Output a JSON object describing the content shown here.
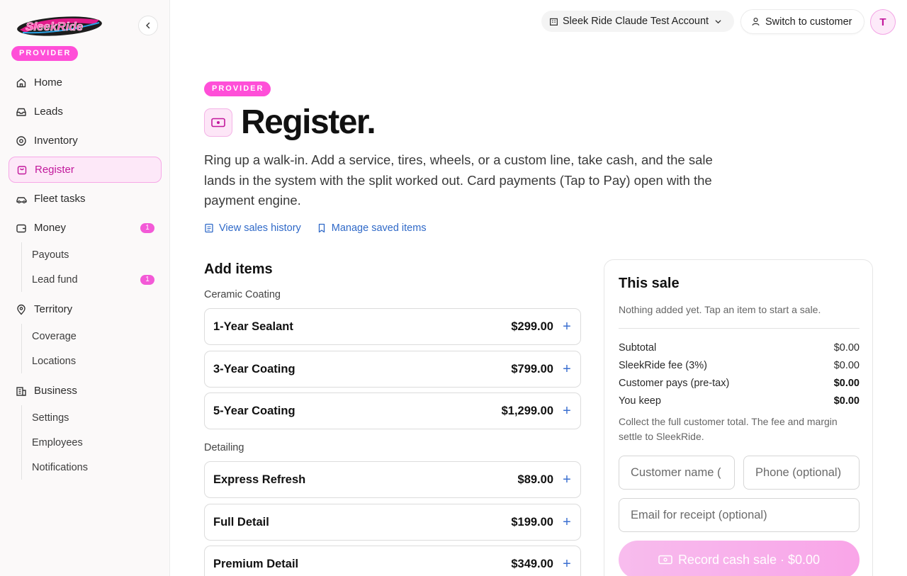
{
  "brand": {
    "logo_text": "SleekRide",
    "role_badge": "PROVIDER",
    "accent": "#ff4fd8"
  },
  "sidebar": {
    "items": [
      {
        "label": "Home",
        "icon": "home-icon"
      },
      {
        "label": "Leads",
        "icon": "inbox-icon"
      },
      {
        "label": "Inventory",
        "icon": "tire-icon"
      },
      {
        "label": "Register",
        "icon": "bag-icon",
        "active": true
      },
      {
        "label": "Fleet tasks",
        "icon": "car-icon"
      },
      {
        "label": "Money",
        "icon": "wallet-icon",
        "badge": "1"
      },
      {
        "label": "Territory",
        "icon": "pin-icon"
      },
      {
        "label": "Business",
        "icon": "building-icon"
      }
    ],
    "money_sub": [
      {
        "label": "Payouts"
      },
      {
        "label": "Lead fund",
        "badge": "1"
      }
    ],
    "territory_sub": [
      {
        "label": "Coverage"
      },
      {
        "label": "Locations"
      }
    ],
    "business_sub": [
      {
        "label": "Settings"
      },
      {
        "label": "Employees"
      },
      {
        "label": "Notifications"
      }
    ]
  },
  "topbar": {
    "account": "Sleek Ride Claude Test Account",
    "switch": "Switch to customer",
    "avatar_initial": "T"
  },
  "header": {
    "badge": "PROVIDER",
    "title": "Register.",
    "description": "Ring up a walk-in. Add a service, tires, wheels, or a custom line, take cash, and the sale lands in the system with the split worked out. Card payments (Tap to Pay) open with the payment engine.",
    "link_history": "View sales history",
    "link_saved": "Manage saved items"
  },
  "add_items": {
    "title": "Add items",
    "categories": [
      {
        "name": "Ceramic Coating",
        "items": [
          {
            "name": "1-Year Sealant",
            "price": "$299.00"
          },
          {
            "name": "3-Year Coating",
            "price": "$799.00"
          },
          {
            "name": "5-Year Coating",
            "price": "$1,299.00"
          }
        ]
      },
      {
        "name": "Detailing",
        "items": [
          {
            "name": "Express Refresh",
            "price": "$89.00"
          },
          {
            "name": "Full Detail",
            "price": "$199.00"
          },
          {
            "name": "Premium Detail",
            "price": "$349.00"
          }
        ]
      }
    ]
  },
  "sale": {
    "title": "This sale",
    "empty": "Nothing added yet. Tap an item to start a sale.",
    "rows": [
      {
        "label": "Subtotal",
        "value": "$0.00"
      },
      {
        "label": "SleekRide fee (3%)",
        "value": "$0.00"
      },
      {
        "label": "Customer pays (pre-tax)",
        "value": "$0.00"
      },
      {
        "label": "You keep",
        "value": "$0.00"
      }
    ],
    "note": "Collect the full customer total. The fee and margin settle to SleekRide.",
    "name_placeholder": "Customer name (",
    "phone_placeholder": "Phone (optional)",
    "email_placeholder": "Email for receipt (optional)",
    "button": "Record cash sale · $0.00"
  }
}
